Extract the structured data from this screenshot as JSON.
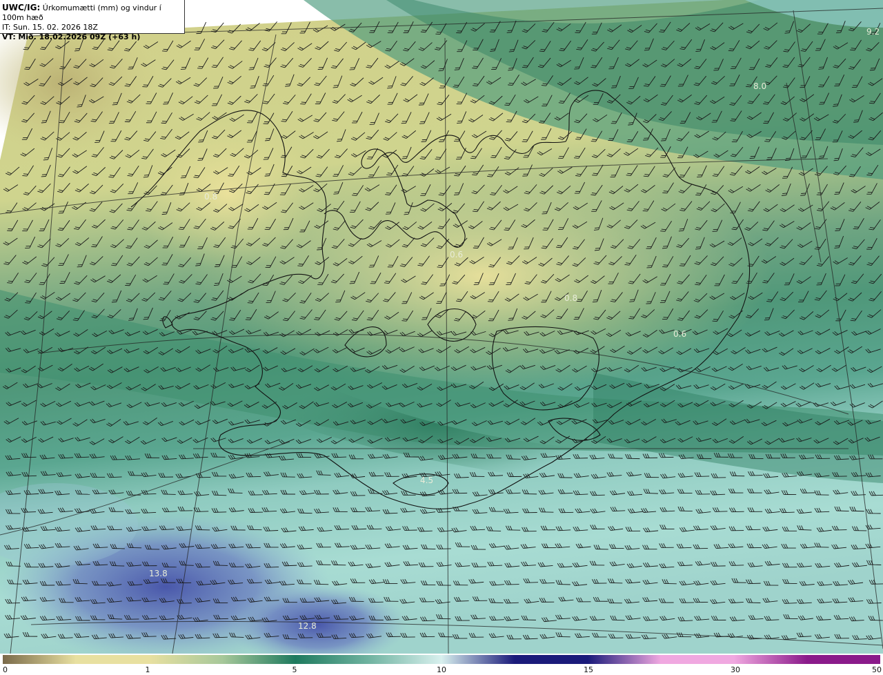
{
  "header": {
    "code": "UWC/IG:",
    "title": "Úrkomumætti (mm) og vindur í 100m hæð",
    "it_line": "IT: Sun. 15. 02. 2026 18Z",
    "vt_label": "VT:",
    "vt_value": "Mið. 18.02.2026 09Z (+63 h)"
  },
  "map_labels": [
    {
      "text": "0.8"
    },
    {
      "text": "0.6"
    },
    {
      "text": "0.8"
    },
    {
      "text": "0.6"
    },
    {
      "text": "8.0"
    },
    {
      "text": "4.5"
    },
    {
      "text": "13.8"
    },
    {
      "text": "12.8"
    },
    {
      "text": "9.2"
    }
  ],
  "colorbar": {
    "ticks": [
      "0",
      "1",
      "5",
      "10",
      "15",
      "30",
      "50"
    ],
    "tick_values": [
      0,
      1,
      5,
      10,
      15,
      30,
      50
    ],
    "colors": {
      "c0": "#7a6a4a",
      "c1": "#e8e0a0",
      "c5": "#1e7a5e",
      "c10": "#d8f0ee",
      "c15": "#1a1a7a",
      "c30": "#f0a8e0",
      "c50": "#8a1a8a"
    }
  },
  "colors": {
    "land_yellow": "#d9d98c",
    "deep_green": "#2f7f62",
    "teal_light": "#a9dbd2",
    "blue_area": "#5f6fb8",
    "coast": "#111111"
  }
}
